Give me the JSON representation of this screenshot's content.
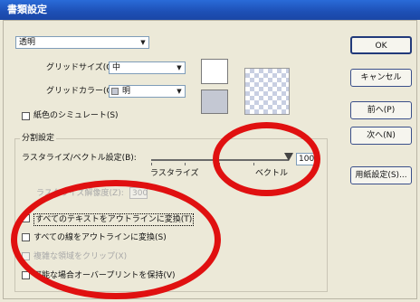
{
  "window": {
    "title": "書類設定"
  },
  "top_dropdown": {
    "value": "透明"
  },
  "grid_size": {
    "label": "グリッドサイズ(G):",
    "value": "中"
  },
  "grid_color": {
    "label": "グリッドカラー(O):",
    "value": "明"
  },
  "paper_sim": {
    "label": "紙色のシミュレート(S)"
  },
  "group_label": "分割設定",
  "raster_vector": {
    "label": "ラスタライズ/ベクトル設定(B):",
    "left_label": "ラスタライズ",
    "right_label": "ベクトル",
    "value": "100"
  },
  "resolution": {
    "label": "ラスタライズ解像度(Z):",
    "value": "300"
  },
  "options": [
    {
      "label": "すべてのテキストをアウトラインに変換(T)",
      "enabled": true
    },
    {
      "label": "すべての線をアウトラインに変換(S)",
      "enabled": true
    },
    {
      "label": "複雑な領域をクリップ(X)",
      "enabled": false
    },
    {
      "label": "可能な場合オーバープリントを保持(V)",
      "enabled": true
    }
  ],
  "buttons": {
    "ok": "OK",
    "cancel": "キャンセル",
    "prev": "前へ(P)",
    "next": "次へ(N)",
    "document_setup": "用紙設定(S)..."
  },
  "colors": {
    "title_bar": "#1d4fb5",
    "annotation_ring": "#e01010",
    "swatch_gray": "#c4c8d3"
  }
}
